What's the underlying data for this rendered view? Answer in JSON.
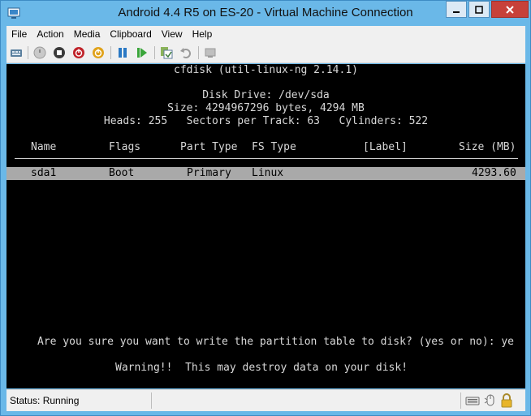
{
  "window": {
    "title": "Android 4.4 R5 on ES-20 - Virtual Machine Connection"
  },
  "menu": {
    "items": [
      "File",
      "Action",
      "Media",
      "Clipboard",
      "View",
      "Help"
    ]
  },
  "toolbar": {
    "icons": [
      "ctrl-alt-del-icon",
      "start-icon",
      "turn-off-icon",
      "shutdown-icon",
      "power-icon",
      "pause-icon",
      "resume-icon",
      "checkpoint-icon",
      "revert-icon",
      "enhanced-session-icon"
    ]
  },
  "console": {
    "header": "cfdisk (util-linux-ng 2.14.1)",
    "disk_drive": "Disk Drive: /dev/sda",
    "size_line": "Size: 4294967296 bytes, 4294 MB",
    "geometry_line": "Heads: 255   Sectors per Track: 63   Cylinders: 522",
    "columns": {
      "name": "Name",
      "flags": "Flags",
      "part_type": "Part Type",
      "fs_type": "FS Type",
      "label": "[Label]",
      "size": "Size (MB)"
    },
    "partition": {
      "name": "sda1",
      "flags": "Boot",
      "part_type": "Primary",
      "fs_type": "Linux",
      "size": "4293.60"
    },
    "prompt": "Are you sure you want to write the partition table to disk? (yes or no): ye",
    "warning": "Warning!!  This may destroy data on your disk!"
  },
  "status": {
    "text": "Status: Running"
  },
  "colors": {
    "titlebar": "#6ab8e8",
    "console_bg": "#000000",
    "console_fg": "#d8d8d8",
    "highlight_row": "#a9a9a9"
  }
}
